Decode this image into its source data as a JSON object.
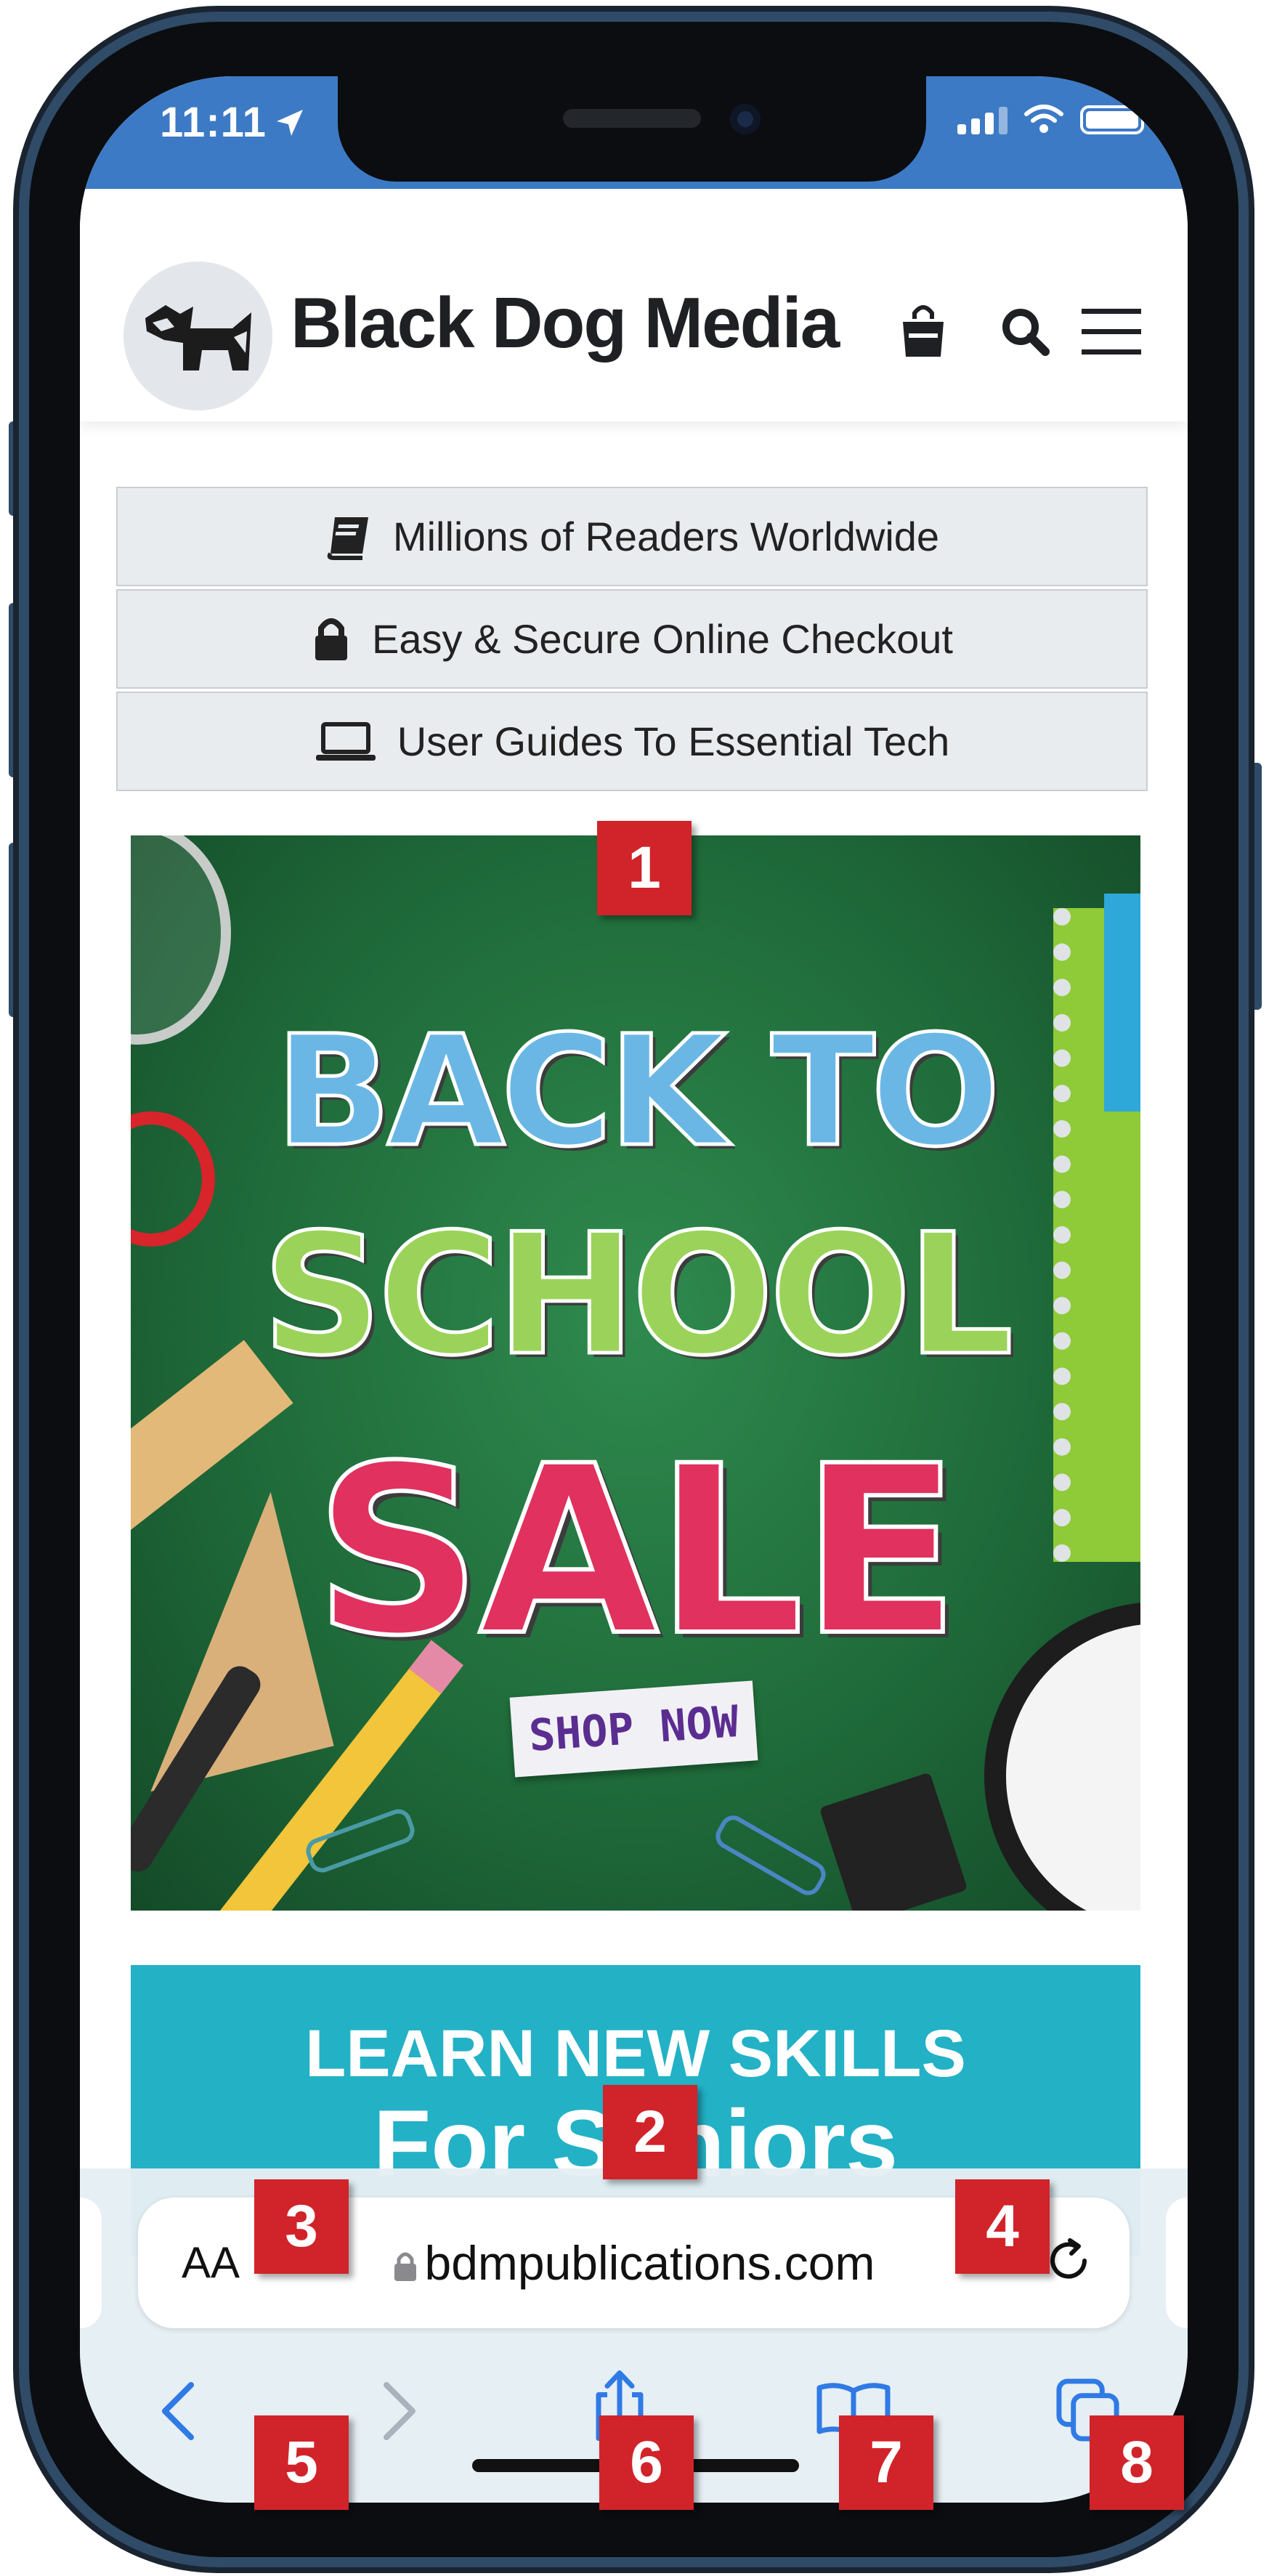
{
  "status_bar": {
    "time": "11:11"
  },
  "site": {
    "name": "Black Dog Media"
  },
  "features": [
    {
      "label": "Millions of Readers Worldwide",
      "icon": "book-icon"
    },
    {
      "label": "Easy & Secure Online Checkout",
      "icon": "lock-icon"
    },
    {
      "label": "User Guides To Essential Tech",
      "icon": "laptop-icon"
    }
  ],
  "banner": {
    "line1": "BACK TO",
    "line2": "SCHOOL",
    "line3": "SALE",
    "cta": "SHOP NOW"
  },
  "banner2": {
    "title": "LEARN NEW SKILLS",
    "subtitle": "For Seniors"
  },
  "browser": {
    "text_size_label": "AA",
    "url": "bdmpublications.com"
  },
  "callouts": [
    "1",
    "2",
    "3",
    "4",
    "5",
    "6",
    "7",
    "8"
  ],
  "colors": {
    "status_bar": "#3d7ac5",
    "callout": "#d1232a",
    "banner_green": "#1f6b3a",
    "banner2_teal": "#23b1c6",
    "link_blue": "#2f7ae5"
  }
}
